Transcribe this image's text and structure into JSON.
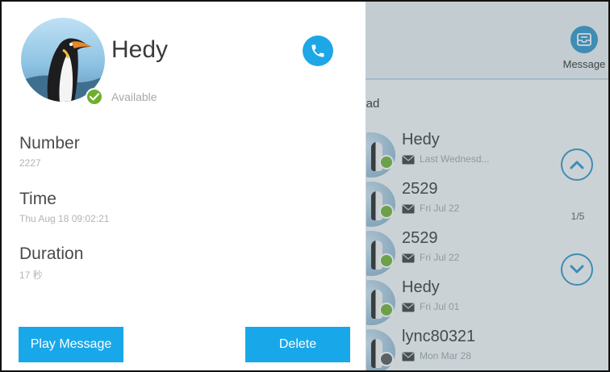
{
  "background_list": {
    "message_button_label": "Message",
    "filter_label": "nread",
    "page_indicator": "1/5",
    "rows": [
      {
        "name": "Hedy",
        "date": "Last Wednesd...",
        "status_color": "#6cb02c"
      },
      {
        "name": "2529",
        "date": "Fri Jul 22",
        "status_color": "#6cb02c"
      },
      {
        "name": "2529",
        "date": "Fri Jul 22",
        "status_color": "#6cb02c"
      },
      {
        "name": "Hedy",
        "date": "Fri Jul 01",
        "status_color": "#6cb02c"
      },
      {
        "name": "lync80321",
        "date": "Mon Mar 28",
        "status_color": "#555555"
      }
    ],
    "icons": {
      "message": "inbox-tray-icon",
      "scroll_up": "chevron-up-icon",
      "scroll_down": "chevron-down-icon",
      "envelope": "envelope-icon"
    }
  },
  "detail": {
    "contact_name": "Hedy",
    "presence": "Available",
    "presence_color": "#6cb02c",
    "fields": {
      "number_label": "Number",
      "number_value": "2227",
      "time_label": "Time",
      "time_value": "Thu Aug 18 09:02:21",
      "duration_label": "Duration",
      "duration_value": "17 秒"
    },
    "buttons": {
      "play": "Play Message",
      "delete": "Delete"
    },
    "icons": {
      "call": "phone-icon",
      "avatar": "penguin-avatar",
      "status": "checkmark-icon"
    }
  },
  "colors": {
    "accent": "#18a8ea",
    "available": "#6cb02c",
    "list_accent": "#2c93c8"
  }
}
